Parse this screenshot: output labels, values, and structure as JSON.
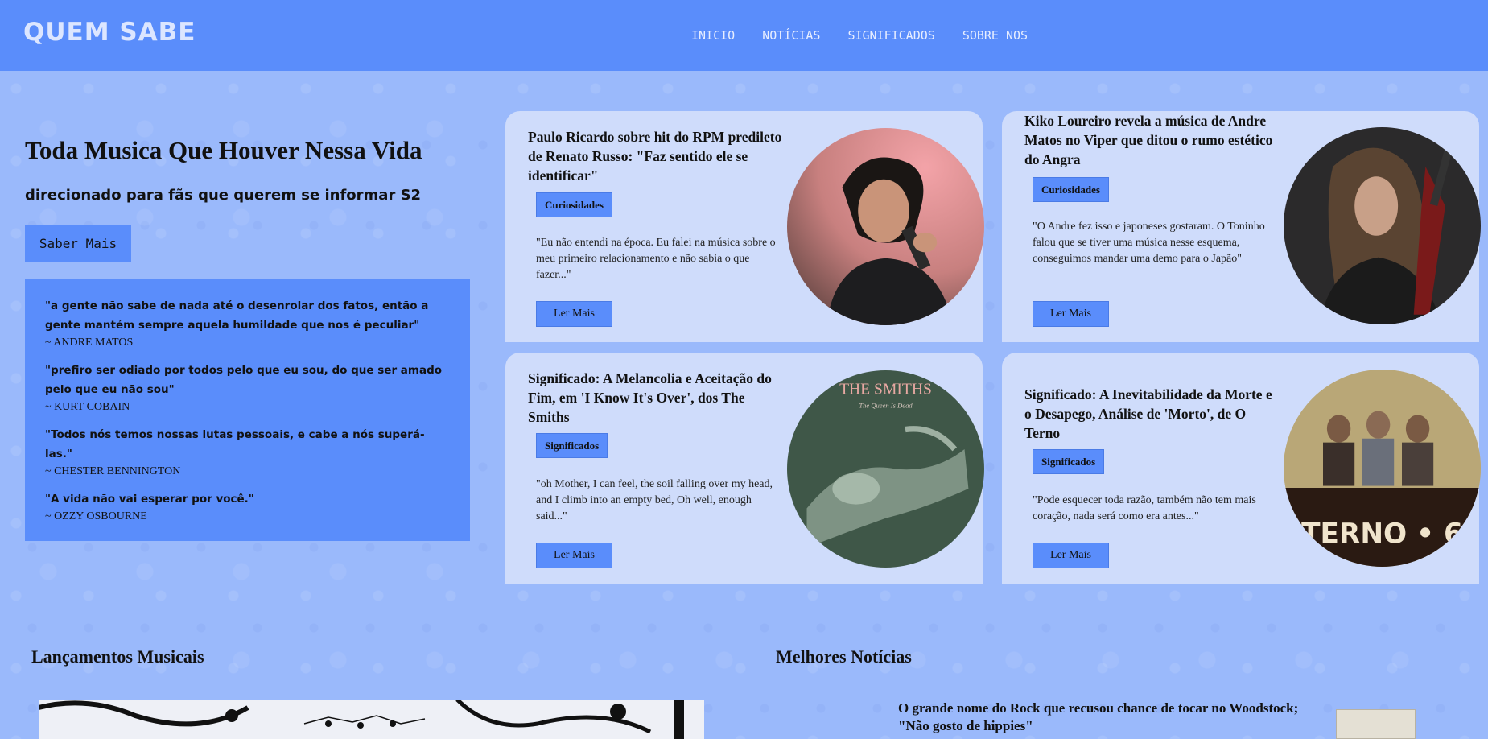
{
  "header": {
    "logo": "QUEM SABE",
    "nav": [
      "INICIO",
      "NOTÍCIAS",
      "SIGNIFICADOS",
      "SOBRE NOS"
    ]
  },
  "hero": {
    "title": "Toda Musica Que Houver Nessa Vida",
    "subtitle": "direcionado para fãs que querem se informar S2",
    "button_label": "Saber Mais"
  },
  "quotes": [
    {
      "text": "\"a gente não sabe de nada até o desenrolar dos fatos, então a gente mantém sempre aquela humildade que nos é peculiar\"",
      "author": "~ ANDRE MATOS"
    },
    {
      "text": "\"prefiro ser odiado por todos pelo que eu sou, do que ser amado pelo que eu não sou\"",
      "author": "~ KURT COBAIN"
    },
    {
      "text": "\"Todos nós temos nossas lutas pessoais, e cabe a nós superá-las.\"",
      "author": "~ CHESTER BENNINGTON"
    },
    {
      "text": "\"A vida não vai esperar por você.\"",
      "author": "~ OZZY OSBOURNE"
    }
  ],
  "cards": [
    {
      "title": "Paulo Ricardo sobre hit do RPM predileto de Renato Russo: \"Faz sentido ele se identificar\"",
      "badge": "Curiosidades",
      "excerpt": "\"Eu não entendi na época. Eu falei na música sobre o meu primeiro relacionamento e não sabia o que fazer...\"",
      "button": "Ler Mais",
      "image": "singer-portrait"
    },
    {
      "title": "Kiko Loureiro revela a música de Andre Matos no Viper que ditou o rumo estético do Angra",
      "badge": "Curiosidades",
      "excerpt": "\"O Andre fez isso e japoneses gostaram. O Toninho falou que se tiver uma música nesse esquema, conseguimos mandar uma demo para o Japão\"",
      "button": "Ler Mais",
      "image": "guitarist-portrait"
    },
    {
      "title": "Significado: A Melancolia e Aceitação do Fim, em 'I Know It's Over', dos The Smiths",
      "badge": "Significados",
      "excerpt": "\"oh Mother, I can feel, the soil falling over my head, and I climb into an empty bed, Oh well, enough said...\"",
      "button": "Ler Mais",
      "image": "album-cover",
      "album_text": "THE SMITHS",
      "album_subtext": "The Queen Is Dead"
    },
    {
      "title": "Significado: A Inevitabilidade da Morte e o Desapego, Análise de 'Morto', de O Terno",
      "badge": "Significados",
      "excerpt": "\"Pode esquecer toda razão, também não tem mais coração, nada será como era antes...\"",
      "button": "Ler Mais",
      "image": "band-photo",
      "band_text": "TERNO • 6"
    }
  ],
  "sections": {
    "releases_title": "Lançamentos Musicais",
    "news_title": "Melhores Notícias",
    "top_news": "O grande nome do Rock que recusou chance de tocar no Woodstock; \"Não gosto de hippies\""
  },
  "colors": {
    "header": "#5a8dfb",
    "background": "#9ab9fb",
    "card": "#cfdcfb",
    "accent": "#5a8dfb"
  }
}
